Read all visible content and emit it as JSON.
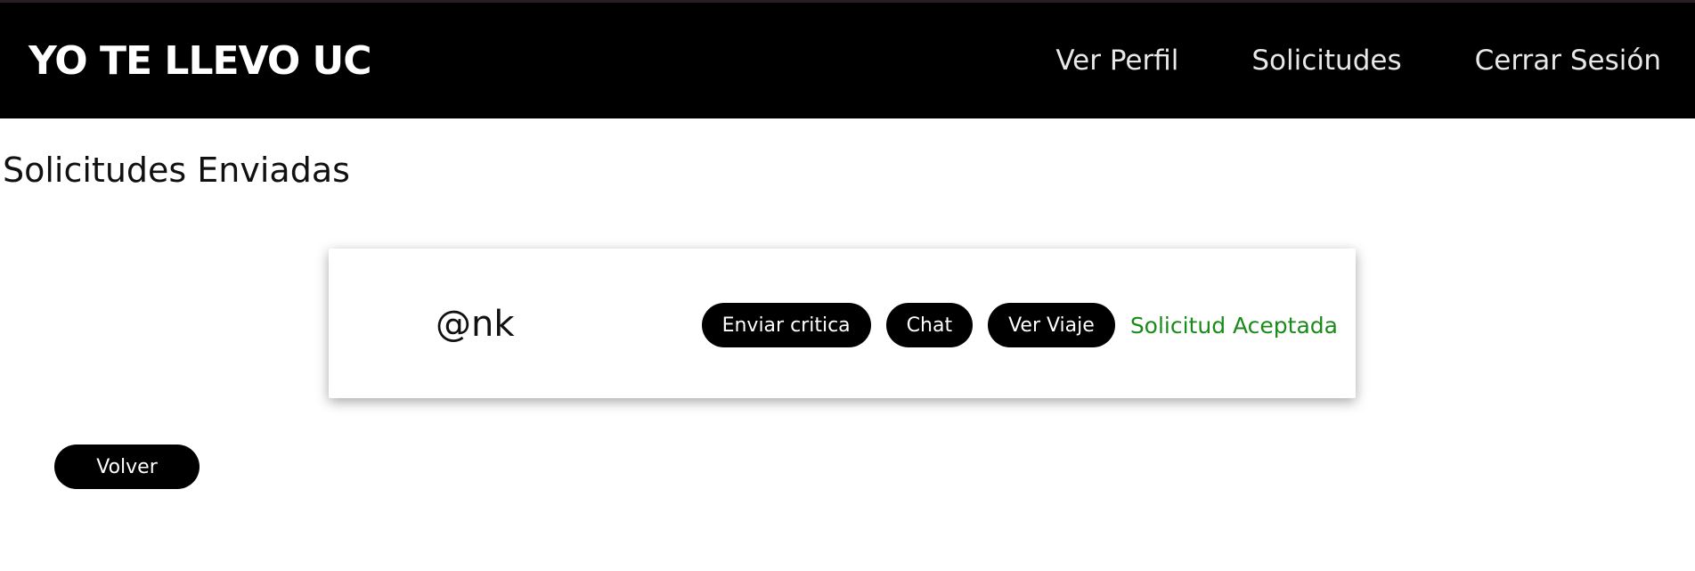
{
  "navbar": {
    "brand": "YO TE LLEVO UC",
    "links": [
      {
        "label": "Ver Perfil"
      },
      {
        "label": "Solicitudes"
      },
      {
        "label": "Cerrar Sesión"
      }
    ]
  },
  "page": {
    "title": "Solicitudes Enviadas"
  },
  "requests": [
    {
      "username": "@nk",
      "actions": {
        "review": "Enviar critica",
        "chat": "Chat",
        "view_trip": "Ver Viaje"
      },
      "status": "Solicitud Aceptada",
      "status_color": "#1a8a1a"
    }
  ],
  "footer": {
    "back_label": "Volver"
  }
}
